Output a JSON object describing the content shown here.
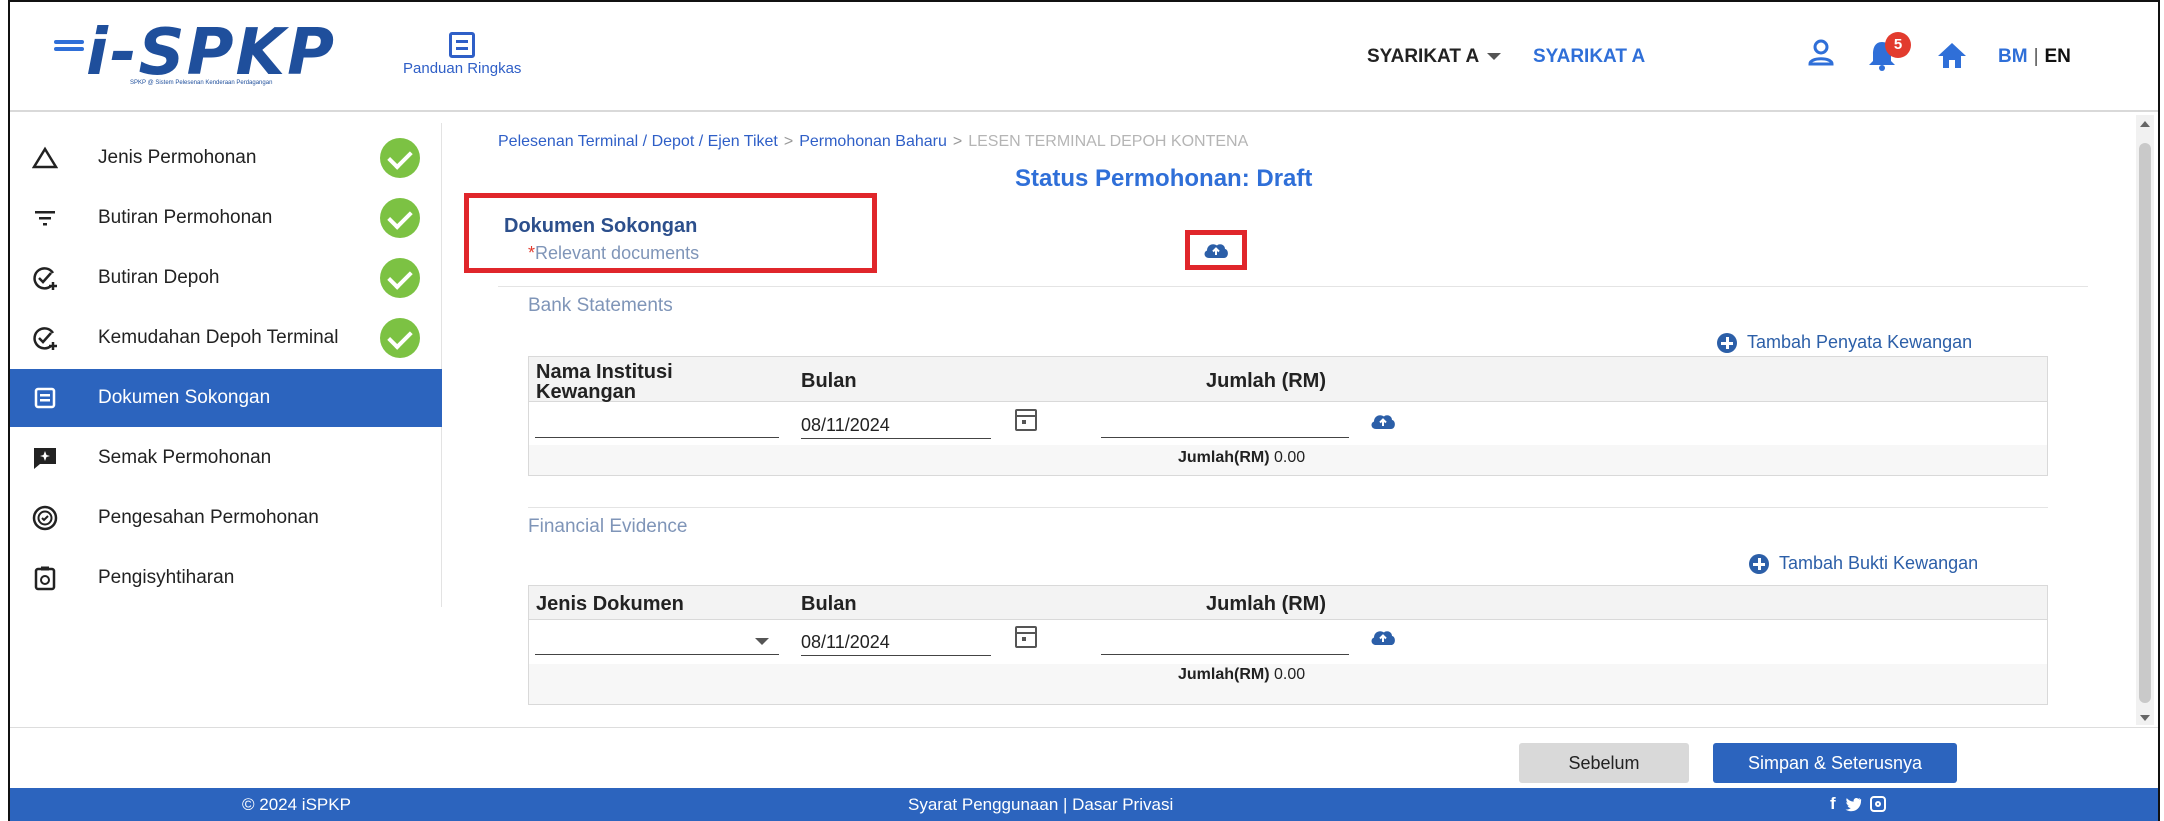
{
  "header": {
    "logo_text": "i-SPKP",
    "logo_subtitle": "SPKP @ Sistem Pelesenan Kenderaan Perdagangan",
    "guide_label": "Panduan Ringkas",
    "company_dropdown": "SYARIKAT A",
    "company_link": "SYARIKAT A",
    "notification_count": "5",
    "lang_bm": "BM",
    "lang_sep": "|",
    "lang_en": "EN"
  },
  "sidebar": {
    "items": [
      {
        "label": "Jenis Permohonan",
        "icon": "triangle-icon",
        "complete": true
      },
      {
        "label": "Butiran Permohonan",
        "icon": "filter-icon",
        "complete": true
      },
      {
        "label": "Butiran Depoh",
        "icon": "check-plus-icon",
        "complete": true
      },
      {
        "label": "Kemudahan Depoh Terminal",
        "icon": "check-plus-icon",
        "complete": true
      },
      {
        "label": "Dokumen Sokongan",
        "icon": "document-icon",
        "active": true
      },
      {
        "label": "Semak Permohonan",
        "icon": "review-icon"
      },
      {
        "label": "Pengesahan Permohonan",
        "icon": "verified-icon"
      },
      {
        "label": "Pengisyhtiharan",
        "icon": "declaration-icon"
      }
    ]
  },
  "breadcrumb": {
    "items": [
      "Pelesenan Terminal / Depot / Ejen Tiket",
      "Permohonan Baharu"
    ],
    "current": "LESEN TERMINAL DEPOH KONTENA",
    "separator": ">"
  },
  "status_title": "Status Permohonan: Draft",
  "section": {
    "title": "Dokumen Sokongan",
    "required_mark": "*",
    "subtitle": "Relevant documents"
  },
  "bank": {
    "title": "Bank Statements",
    "add_label": "Tambah Penyata Kewangan",
    "col_institution": "Nama Institusi Kewangan",
    "col_month": "Bulan",
    "col_amount": "Jumlah (RM)",
    "month_value": "08/11/2024",
    "total_label": "Jumlah(RM)",
    "total_value": "0.00"
  },
  "financial": {
    "title": "Financial Evidence",
    "add_label": "Tambah Bukti Kewangan",
    "col_doc_type": "Jenis Dokumen",
    "col_month": "Bulan",
    "col_amount": "Jumlah (RM)",
    "month_value": "08/11/2024",
    "total_label": "Jumlah(RM)",
    "total_value": "0.00"
  },
  "actions": {
    "prev_label": "Sebelum",
    "next_label": "Simpan & Seterusnya"
  },
  "footer": {
    "copyright": "© 2024 iSPKP",
    "links": "Syarat Penggunaan | Dasar Privasi",
    "facebook": "f"
  },
  "colors": {
    "primary": "#2c64be",
    "link": "#2f6fd8",
    "success": "#7cc243",
    "highlight": "#e0262b",
    "badge": "#e23b2e"
  }
}
